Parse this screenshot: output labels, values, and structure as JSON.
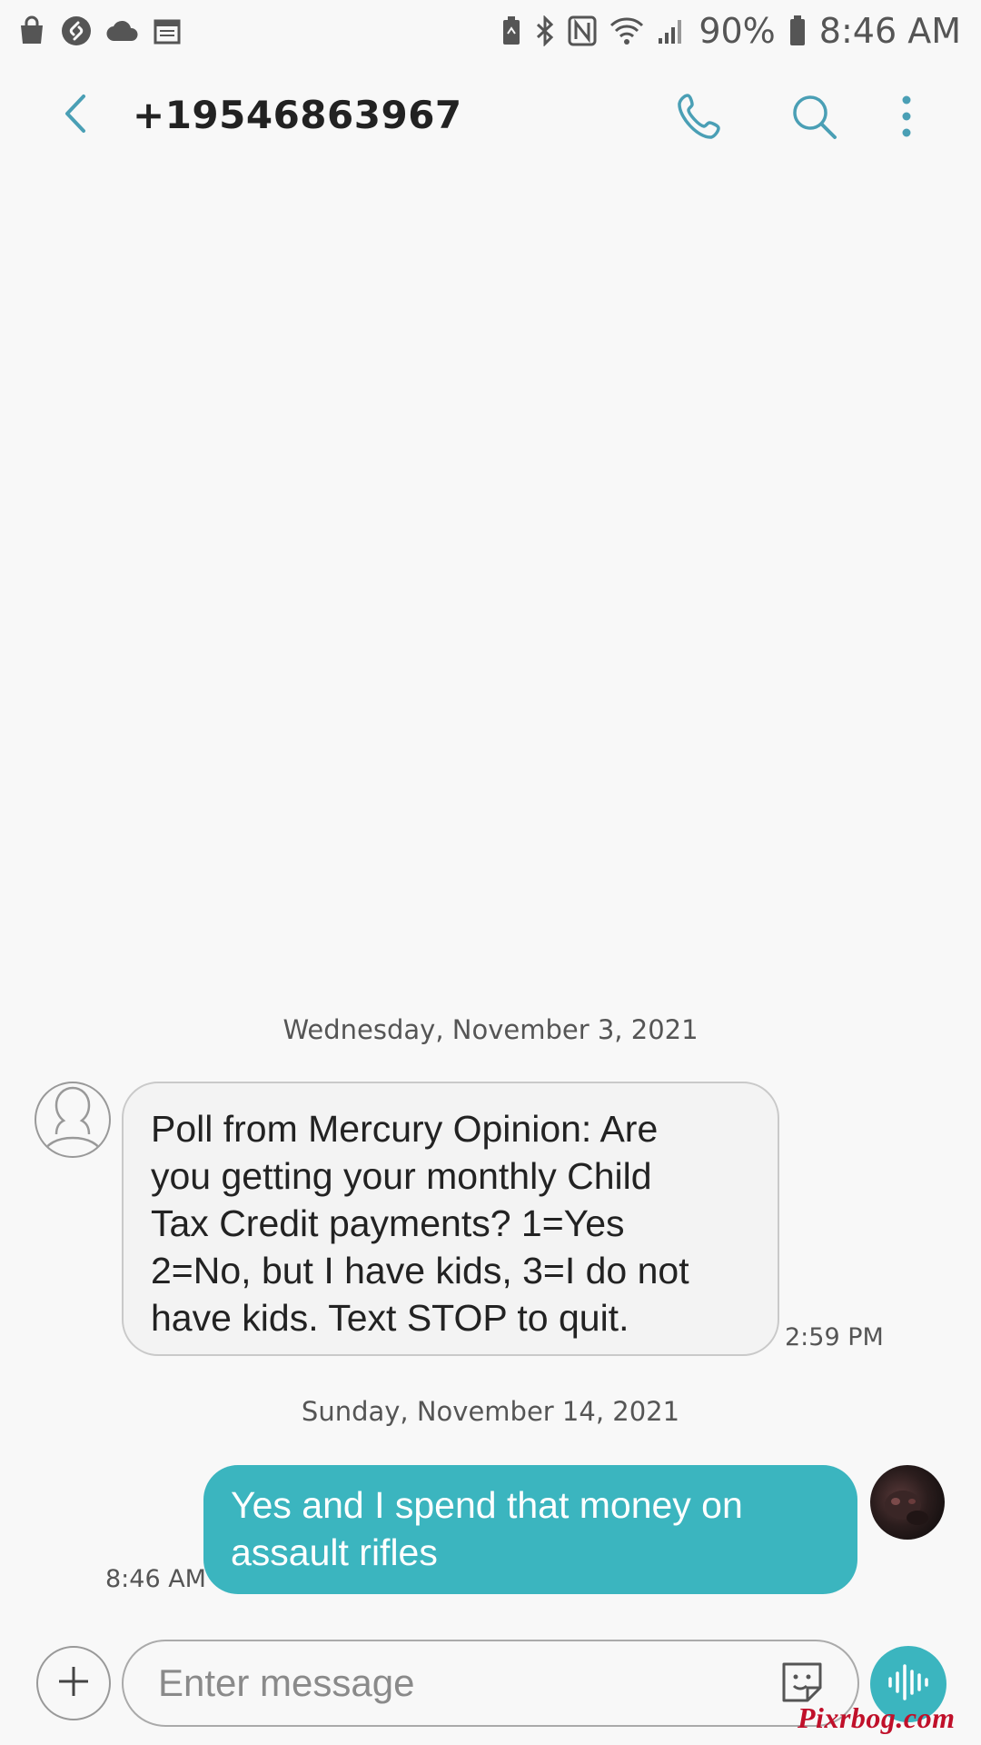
{
  "status_bar": {
    "left_icons": [
      "shopping-bag-icon",
      "shazam-icon",
      "cloud-icon",
      "calendar-icon"
    ],
    "right_icons": [
      "battery-saver-icon",
      "bluetooth-icon",
      "nfc-icon",
      "wifi-icon",
      "signal-icon",
      "battery-icon"
    ],
    "battery": "90%",
    "time": "8:46 AM"
  },
  "header": {
    "title": "+19546863967",
    "icons": [
      "back-icon",
      "phone-icon",
      "search-icon",
      "more-options-icon"
    ]
  },
  "conversation": {
    "date_1": "Wednesday, November 3, 2021",
    "incoming_lines": [
      "Poll from Mercury Opinion: Are",
      "you getting your monthly Child",
      "Tax Credit payments? 1=Yes",
      "2=No, but I have kids, 3=I do not",
      "have kids. Text STOP to quit."
    ],
    "incoming_time": "2:59 PM",
    "date_2": "Sunday, November 14, 2021",
    "outgoing_lines": [
      "Yes and I spend that money on",
      "assault rifles"
    ],
    "outgoing_time": "8:46 AM"
  },
  "composer": {
    "placeholder": "Enter message",
    "value": "",
    "icons": [
      "add-icon",
      "sticker-icon",
      "voice-icon"
    ]
  },
  "watermark": "Pixrbog.com",
  "colors": {
    "accent": "#3bb5bf",
    "background": "#f8f8f8",
    "incoming_bubble": "#f3f3f3",
    "header_icon": "#4a9fb5"
  }
}
